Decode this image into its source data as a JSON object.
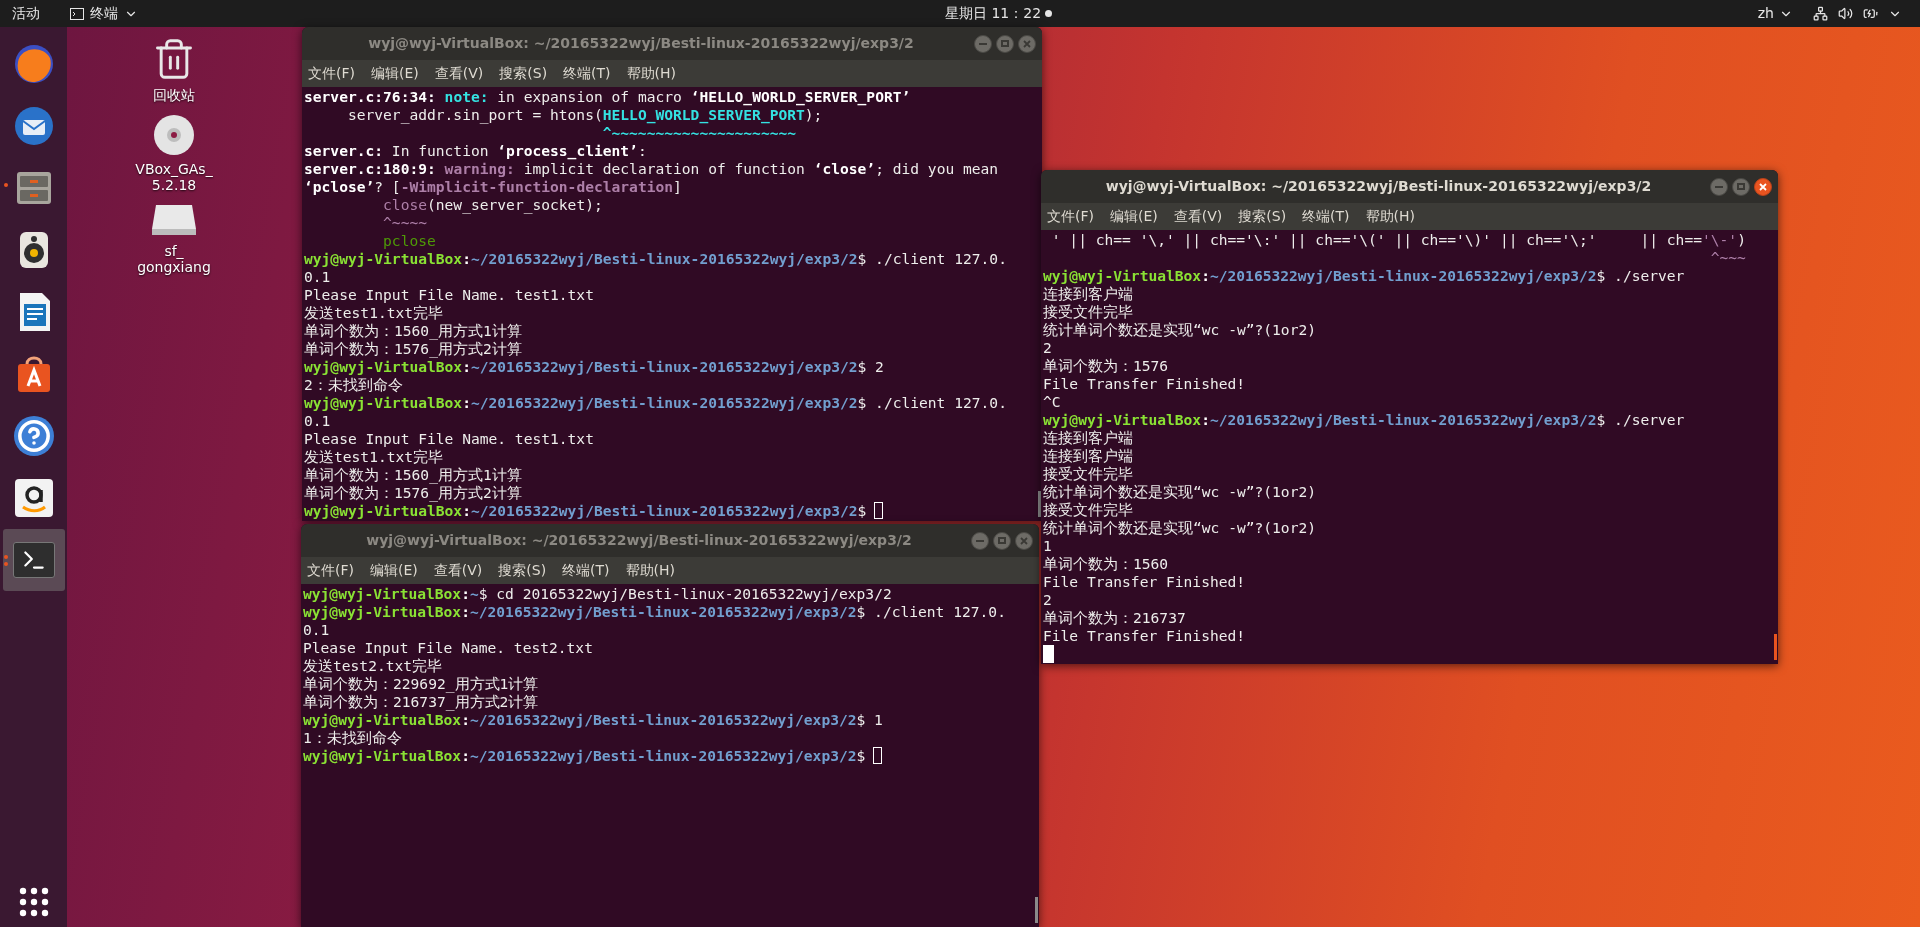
{
  "top_bar": {
    "activities": "活动",
    "app_menu": "终端",
    "clock": "星期日 11：22",
    "language": "zh"
  },
  "dock": {
    "items": [
      {
        "kind": "firefox",
        "running": false,
        "selected": false
      },
      {
        "kind": "thunderbird",
        "running": false,
        "selected": false
      },
      {
        "kind": "files",
        "running": true,
        "selected": false
      },
      {
        "kind": "rhythmbox",
        "running": false,
        "selected": false
      },
      {
        "kind": "writer",
        "running": false,
        "selected": false
      },
      {
        "kind": "software",
        "running": false,
        "selected": false
      },
      {
        "kind": "help",
        "running": false,
        "selected": false
      },
      {
        "kind": "amazon",
        "running": false,
        "selected": false
      },
      {
        "kind": "terminal",
        "running": true,
        "selected": true
      }
    ]
  },
  "desktop_icons": [
    {
      "kind": "trash",
      "label_lines": [
        "回收站"
      ]
    },
    {
      "kind": "disc",
      "label_lines": [
        "VBox_GAs_",
        "5.2.18"
      ]
    },
    {
      "kind": "drive",
      "label_lines": [
        "sf_",
        "gongxiang"
      ]
    }
  ],
  "windows": [
    {
      "title": "wyj@wyj-VirtualBox: ~/20165322wyj/Besti-linux-20165322wyj/exp3/2",
      "focused": false,
      "cursor_on_new_line": false,
      "menu": [
        "文件(F)",
        "编辑(E)",
        "查看(V)",
        "搜索(S)",
        "终端(T)",
        "帮助(H)"
      ],
      "lines": [
        [
          {
            "kind": "bold",
            "t": "server.c:76:34: "
          },
          {
            "kind": "note",
            "t": "note:"
          },
          {
            "kind": "plain",
            "t": " in expansion of macro "
          },
          {
            "kind": "bold",
            "t": "‘HELLO_WORLD_SERVER_PORT’"
          }
        ],
        [
          {
            "kind": "plain",
            "t": "     server_addr.sin_port = htons("
          },
          {
            "kind": "cyan",
            "t": "HELLO_WORLD_SERVER_PORT"
          },
          {
            "kind": "plain",
            "t": ");"
          }
        ],
        [
          {
            "kind": "cyan",
            "t": "                                  ^~~~~~~~~~~~~~~~~~~~~~"
          }
        ],
        [
          {
            "kind": "bold",
            "t": "server.c:"
          },
          {
            "kind": "plain",
            "t": " In function "
          },
          {
            "kind": "bold",
            "t": "‘process_client’"
          },
          {
            "kind": "plain",
            "t": ":"
          }
        ],
        [
          {
            "kind": "bold",
            "t": "server.c:180:9: "
          },
          {
            "kind": "warning",
            "t": "warning:"
          },
          {
            "kind": "plain",
            "t": " implicit declaration of function "
          },
          {
            "kind": "bold",
            "t": "‘close’"
          },
          {
            "kind": "plain",
            "t": "; did you mean"
          }
        ],
        [
          {
            "kind": "bold",
            "t": "‘pclose’"
          },
          {
            "kind": "plain",
            "t": "? ["
          },
          {
            "kind": "warning",
            "t": "-Wimplicit-function-declaration"
          },
          {
            "kind": "plain",
            "t": "]"
          }
        ],
        [
          {
            "kind": "purple",
            "t": "         close"
          },
          {
            "kind": "plain",
            "t": "(new_server_socket);"
          }
        ],
        [
          {
            "kind": "purple",
            "t": "         ^~~~~"
          }
        ],
        [
          {
            "kind": "green",
            "t": "         pclose"
          }
        ],
        [
          {
            "kind": "user",
            "t": "wyj@wyj-VirtualBox"
          },
          {
            "kind": "bold",
            "t": ":"
          },
          {
            "kind": "path",
            "t": "~/20165322wyj/Besti-linux-20165322wyj/exp3/2"
          },
          {
            "kind": "plain",
            "t": "$ ./client 127.0."
          }
        ],
        [
          {
            "kind": "plain",
            "t": "0.1"
          }
        ],
        [
          {
            "kind": "plain",
            "t": "Please Input File Name. test1.txt"
          }
        ],
        [
          {
            "kind": "plain",
            "t": "发送test1.txt完毕"
          }
        ],
        [
          {
            "kind": "plain",
            "t": "单词个数为：1560_用方式1计算"
          }
        ],
        [
          {
            "kind": "plain",
            "t": "单词个数为：1576_用方式2计算"
          }
        ],
        [
          {
            "kind": "user",
            "t": "wyj@wyj-VirtualBox"
          },
          {
            "kind": "bold",
            "t": ":"
          },
          {
            "kind": "path",
            "t": "~/20165322wyj/Besti-linux-20165322wyj/exp3/2"
          },
          {
            "kind": "plain",
            "t": "$ 2"
          }
        ],
        [
          {
            "kind": "plain",
            "t": "2：未找到命令"
          }
        ],
        [
          {
            "kind": "user",
            "t": "wyj@wyj-VirtualBox"
          },
          {
            "kind": "bold",
            "t": ":"
          },
          {
            "kind": "path",
            "t": "~/20165322wyj/Besti-linux-20165322wyj/exp3/2"
          },
          {
            "kind": "plain",
            "t": "$ ./client 127.0."
          }
        ],
        [
          {
            "kind": "plain",
            "t": "0.1"
          }
        ],
        [
          {
            "kind": "plain",
            "t": "Please Input File Name. test1.txt"
          }
        ],
        [
          {
            "kind": "plain",
            "t": "发送test1.txt完毕"
          }
        ],
        [
          {
            "kind": "plain",
            "t": "单词个数为：1560_用方式1计算"
          }
        ],
        [
          {
            "kind": "plain",
            "t": "单词个数为：1576_用方式2计算"
          }
        ],
        [
          {
            "kind": "user",
            "t": "wyj@wyj-VirtualBox"
          },
          {
            "kind": "bold",
            "t": ":"
          },
          {
            "kind": "path",
            "t": "~/20165322wyj/Besti-linux-20165322wyj/exp3/2"
          },
          {
            "kind": "plain",
            "t": "$"
          }
        ]
      ]
    },
    {
      "title": "wyj@wyj-VirtualBox: ~/20165322wyj/Besti-linux-20165322wyj/exp3/2",
      "focused": false,
      "cursor_on_new_line": false,
      "menu": [
        "文件(F)",
        "编辑(E)",
        "查看(V)",
        "搜索(S)",
        "终端(T)",
        "帮助(H)"
      ],
      "lines": [
        [
          {
            "kind": "user",
            "t": "wyj@wyj-VirtualBox"
          },
          {
            "kind": "bold",
            "t": ":"
          },
          {
            "kind": "path",
            "t": "~"
          },
          {
            "kind": "plain",
            "t": "$ cd 20165322wyj/Besti-linux-20165322wyj/exp3/2"
          }
        ],
        [
          {
            "kind": "user",
            "t": "wyj@wyj-VirtualBox"
          },
          {
            "kind": "bold",
            "t": ":"
          },
          {
            "kind": "path",
            "t": "~/20165322wyj/Besti-linux-20165322wyj/exp3/2"
          },
          {
            "kind": "plain",
            "t": "$ ./client 127.0."
          }
        ],
        [
          {
            "kind": "plain",
            "t": "0.1"
          }
        ],
        [
          {
            "kind": "plain",
            "t": "Please Input File Name. test2.txt"
          }
        ],
        [
          {
            "kind": "plain",
            "t": "发送test2.txt完毕"
          }
        ],
        [
          {
            "kind": "plain",
            "t": "单词个数为：229692_用方式1计算"
          }
        ],
        [
          {
            "kind": "plain",
            "t": "单词个数为：216737_用方式2计算"
          }
        ],
        [
          {
            "kind": "user",
            "t": "wyj@wyj-VirtualBox"
          },
          {
            "kind": "bold",
            "t": ":"
          },
          {
            "kind": "path",
            "t": "~/20165322wyj/Besti-linux-20165322wyj/exp3/2"
          },
          {
            "kind": "plain",
            "t": "$ 1"
          }
        ],
        [
          {
            "kind": "plain",
            "t": "1：未找到命令"
          }
        ],
        [
          {
            "kind": "user",
            "t": "wyj@wyj-VirtualBox"
          },
          {
            "kind": "bold",
            "t": ":"
          },
          {
            "kind": "path",
            "t": "~/20165322wyj/Besti-linux-20165322wyj/exp3/2"
          },
          {
            "kind": "plain",
            "t": "$"
          }
        ]
      ]
    },
    {
      "title": "wyj@wyj-VirtualBox: ~/20165322wyj/Besti-linux-20165322wyj/exp3/2",
      "focused": true,
      "cursor_on_new_line": true,
      "menu": [
        "文件(F)",
        "编辑(E)",
        "查看(V)",
        "搜索(S)",
        "终端(T)",
        "帮助(H)"
      ],
      "lines": [
        [
          {
            "kind": "plain",
            "t": " ' || ch== '\\,' || ch=='\\:' || ch=='\\(' || ch=='\\)' || ch=='\\;'     || ch=="
          },
          {
            "kind": "purple",
            "t": "'\\-'"
          },
          {
            "kind": "plain",
            "t": ")"
          }
        ],
        [
          {
            "kind": "purple",
            "t": "                                                                            ^~~~"
          }
        ],
        [
          {
            "kind": "user",
            "t": "wyj@wyj-VirtualBox"
          },
          {
            "kind": "bold",
            "t": ":"
          },
          {
            "kind": "path",
            "t": "~/20165322wyj/Besti-linux-20165322wyj/exp3/2"
          },
          {
            "kind": "plain",
            "t": "$ ./server"
          }
        ],
        [
          {
            "kind": "plain",
            "t": "连接到客户端"
          }
        ],
        [
          {
            "kind": "plain",
            "t": "接受文件完毕"
          }
        ],
        [
          {
            "kind": "plain",
            "t": "统计单词个数还是实现“wc -w”?(1or2)"
          }
        ],
        [
          {
            "kind": "plain",
            "t": "2"
          }
        ],
        [
          {
            "kind": "plain",
            "t": "单词个数为：1576"
          }
        ],
        [
          {
            "kind": "plain",
            "t": "File Transfer Finished!"
          }
        ],
        [
          {
            "kind": "plain",
            "t": "^C"
          }
        ],
        [
          {
            "kind": "user",
            "t": "wyj@wyj-VirtualBox"
          },
          {
            "kind": "bold",
            "t": ":"
          },
          {
            "kind": "path",
            "t": "~/20165322wyj/Besti-linux-20165322wyj/exp3/2"
          },
          {
            "kind": "plain",
            "t": "$ ./server"
          }
        ],
        [
          {
            "kind": "plain",
            "t": "连接到客户端"
          }
        ],
        [
          {
            "kind": "plain",
            "t": "连接到客户端"
          }
        ],
        [
          {
            "kind": "plain",
            "t": "接受文件完毕"
          }
        ],
        [
          {
            "kind": "plain",
            "t": "统计单词个数还是实现“wc -w”?(1or2)"
          }
        ],
        [
          {
            "kind": "plain",
            "t": "接受文件完毕"
          }
        ],
        [
          {
            "kind": "plain",
            "t": "统计单词个数还是实现“wc -w”?(1or2)"
          }
        ],
        [
          {
            "kind": "plain",
            "t": "1"
          }
        ],
        [
          {
            "kind": "plain",
            "t": "单词个数为：1560"
          }
        ],
        [
          {
            "kind": "plain",
            "t": "File Transfer Finished!"
          }
        ],
        [
          {
            "kind": "plain",
            "t": "2"
          }
        ],
        [
          {
            "kind": "plain",
            "t": "单词个数为：216737"
          }
        ],
        [
          {
            "kind": "plain",
            "t": "File Transfer Finished!"
          }
        ]
      ]
    }
  ]
}
